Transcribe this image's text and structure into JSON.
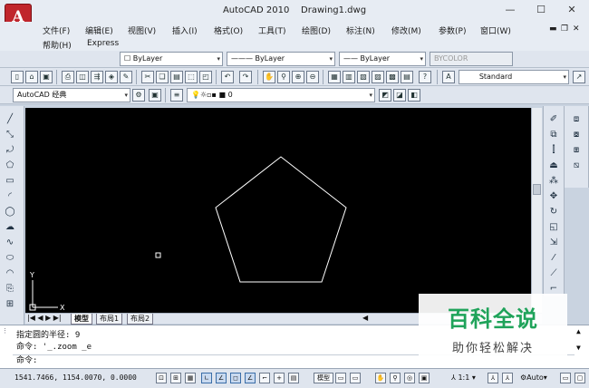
{
  "app": {
    "logo_letter": "A",
    "title": "AutoCAD 2010",
    "document": "Drawing1.dwg"
  },
  "window_controls": {
    "minimize": "—",
    "maximize": "☐",
    "close": "✕"
  },
  "menus": [
    "文件(F)",
    "编辑(E)",
    "视图(V)",
    "插入(I)",
    "格式(O)",
    "工具(T)",
    "绘图(D)",
    "标注(N)",
    "修改(M)",
    "参数(P)",
    "窗口(W)",
    "帮助(H)",
    "Express"
  ],
  "layer_props": {
    "color": "ByLayer",
    "linetype": "ByLayer",
    "lineweight": "ByLayer",
    "plotstyle": "BYCOLOR"
  },
  "text_style": "Standard",
  "workspace": "AutoCAD 经典",
  "layer": {
    "name": "0"
  },
  "layout_tabs": {
    "model": "模型",
    "layout1": "布局1",
    "layout2": "布局2"
  },
  "ucs": {
    "x_label": "X",
    "y_label": "Y"
  },
  "command": {
    "line1": "指定圆的半径: 9",
    "line2": "命令: '_.zoom _e",
    "prompt": "命令:"
  },
  "status": {
    "coords": "1541.7466, 1154.0070, 0.0000",
    "model_label": "模型",
    "scale": "1:1",
    "auto": "Auto"
  },
  "watermark": {
    "big": "百科全说",
    "small": "助你轻松解决"
  },
  "colors": {
    "canvas": "#000000",
    "logo_red": "#c0262c",
    "watermark_green": "#1fa35a"
  }
}
